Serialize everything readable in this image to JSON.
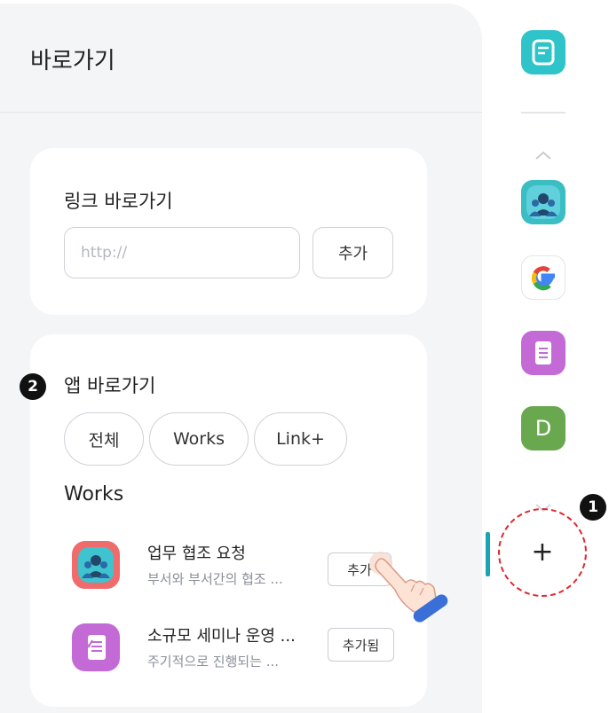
{
  "panel": {
    "title": "바로가기"
  },
  "link_shortcut": {
    "title": "링크 바로가기",
    "input_placeholder": "http://",
    "input_value": "",
    "add_label": "추가"
  },
  "app_shortcut": {
    "step_badge": "2",
    "title": "앱 바로가기",
    "filters": [
      "전체",
      "Works",
      "Link+"
    ],
    "section_label": "Works",
    "apps": [
      {
        "name": "업무 협조 요청",
        "desc": "부서와 부서간의 협조 ...",
        "button": "추가",
        "icon": "collaboration-app-icon"
      },
      {
        "name": "소규모 세미나 운영 ...",
        "desc": "주기적으로 진행되는 ...",
        "button": "추가됨",
        "icon": "seminar-app-icon"
      }
    ]
  },
  "rail": {
    "items": [
      {
        "icon": "memo-icon",
        "color": "#2ec4c9"
      },
      {
        "icon": "collaboration-app-icon",
        "color": "#3bbdc4"
      },
      {
        "icon": "google-icon",
        "color": "#ffffff"
      },
      {
        "icon": "document-app-icon",
        "color": "#c36ad6"
      },
      {
        "letter": "D",
        "icon": "letter-avatar-icon",
        "color": "#6aa84f"
      }
    ],
    "step_badge": "1",
    "add_symbol": "+"
  },
  "colors": {
    "accent_teal": "#1aa5b5",
    "highlight_red": "#e0262e",
    "panel_bg": "#f4f5f7"
  }
}
